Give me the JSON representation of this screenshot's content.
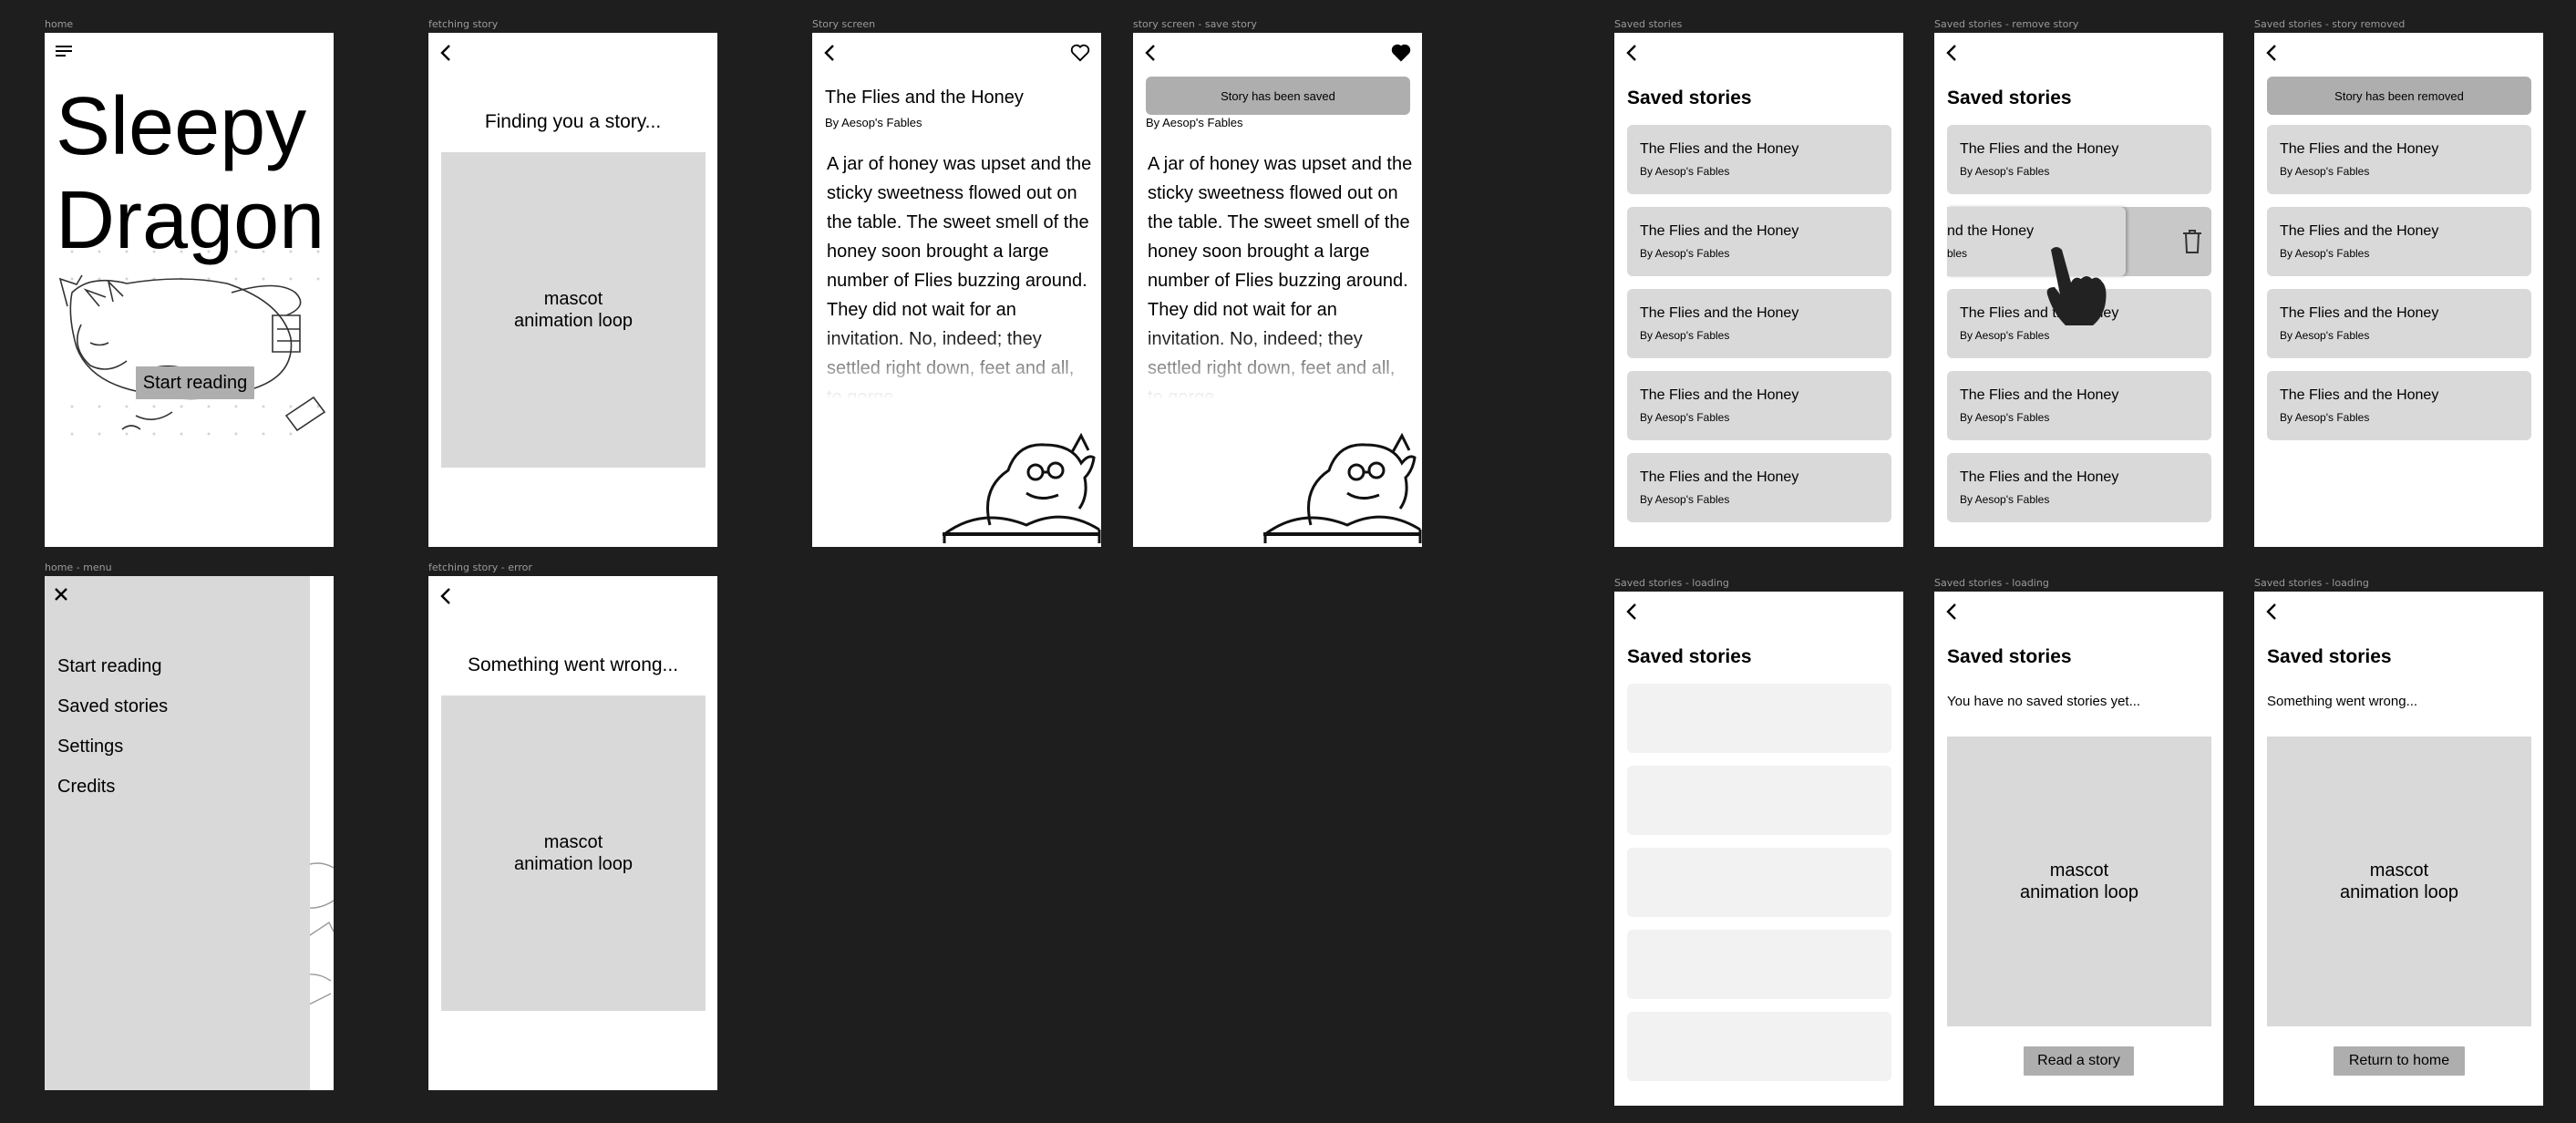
{
  "frame_labels": {
    "home": "home",
    "fetching": "fetching story",
    "story": "Story screen",
    "story_saved": "story screen - save story",
    "saved": "Saved stories",
    "saved_remove": "Saved stories - remove story",
    "saved_removed": "Saved stories - story removed",
    "home_menu": "home - menu",
    "fetch_error": "fetching story - error",
    "saved_loading_1": "Saved stories - loading",
    "saved_loading_2": "Saved stories - loading",
    "saved_loading_3": "Saved stories - loading"
  },
  "home": {
    "title_line1": "Sleepy",
    "title_line2": "Dragon",
    "start_button": "Start reading"
  },
  "menu": {
    "items": [
      "Start reading",
      "Saved stories",
      "Settings",
      "Credits"
    ]
  },
  "fetching": {
    "message": "Finding you a story...",
    "error_message": "Something went wrong...",
    "placeholder": "mascot\nanimation loop"
  },
  "story": {
    "title": "The Flies and the Honey",
    "author": "By Aesop's Fables",
    "body": "A jar of honey was upset and the sticky sweetness flowed out on the table. The sweet smell of the honey soon brought a large number of Flies buzzing around. They did not wait for an invitation. No, indeed; they settled right down, feet and all, to gorge.",
    "saved_toast": "Story has been saved"
  },
  "saved": {
    "title": "Saved stories",
    "card_title": "The Flies and the Honey",
    "card_author": "By Aesop's Fables",
    "swiped_title": "nd the Honey",
    "swiped_author": "bles",
    "removed_toast": "Story has been removed",
    "empty_message": "You have no saved stories yet...",
    "error_message": "Something went wrong...",
    "placeholder": "mascot\nanimation loop",
    "read_button": "Read a story",
    "home_button": "Return to home"
  },
  "colors": {
    "canvas": "#1e1e1e",
    "frame": "#ffffff",
    "card": "#d9d9d9",
    "skeleton": "#f2f2f2",
    "toast": "#aeaeae"
  }
}
